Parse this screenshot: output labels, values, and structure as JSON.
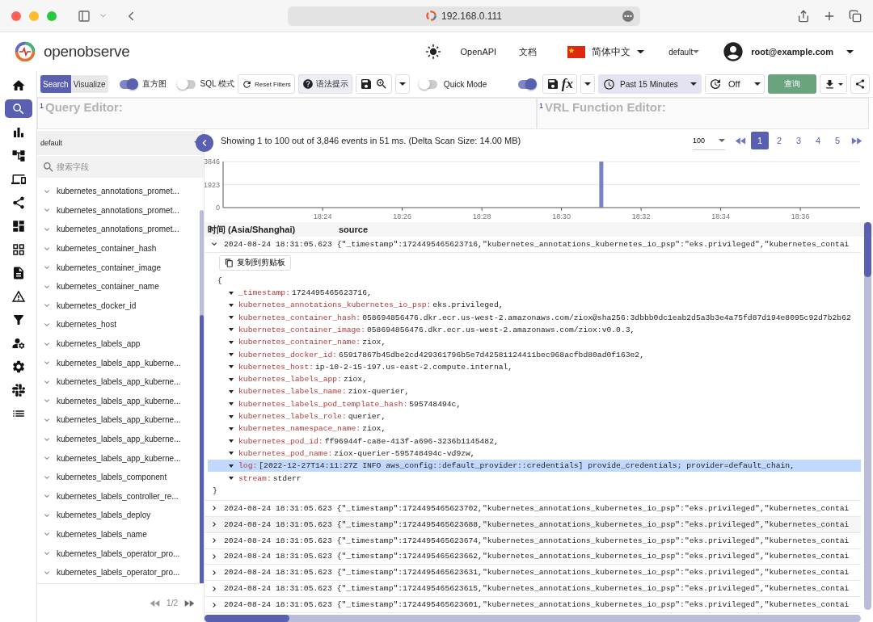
{
  "browser": {
    "url": "192.168.0.111"
  },
  "header": {
    "logo": "openobserve",
    "links": [
      "OpenAPI",
      "文档"
    ],
    "language": "简体中文",
    "org": "default",
    "user": "root@example.com"
  },
  "nav": [
    {
      "kind": "home",
      "selected": false
    },
    {
      "kind": "search",
      "selected": true
    },
    {
      "kind": "metrics",
      "selected": false
    },
    {
      "kind": "traces",
      "selected": false
    },
    {
      "kind": "devices",
      "selected": false
    },
    {
      "kind": "share",
      "selected": false
    },
    {
      "kind": "dashboards",
      "selected": false
    },
    {
      "kind": "grid",
      "selected": false
    },
    {
      "kind": "reports",
      "selected": false
    },
    {
      "kind": "alerts",
      "selected": false
    },
    {
      "kind": "filter",
      "selected": false
    },
    {
      "kind": "users",
      "selected": false
    },
    {
      "kind": "settings",
      "selected": false
    },
    {
      "kind": "slack",
      "selected": false
    },
    {
      "kind": "list",
      "selected": false
    }
  ],
  "toolbar": {
    "tabs": [
      {
        "label": "Search",
        "selected": true
      },
      {
        "label": "Visualize",
        "selected": false
      }
    ],
    "histogram": {
      "label": "直方图",
      "on": true
    },
    "sql_mode": {
      "label": "SQL 模式",
      "on": false
    },
    "reset": "Reset Filters",
    "syntax": "语法提示",
    "quick_mode": {
      "label": "Quick Mode",
      "on": false
    },
    "vrl": {
      "on": true
    },
    "function_label": "fx",
    "time_range": "Past 15 Minutes",
    "refresh": "Off",
    "run": "查询"
  },
  "editors": {
    "query": {
      "line": "1",
      "placeholder": "Query Editor:"
    },
    "vrl": {
      "line": "1",
      "placeholder": "VRL Function Editor:"
    }
  },
  "fields_panel": {
    "stream": "default",
    "search_placeholder": "搜索字段",
    "fields": [
      "kubernetes_annotations_promet...",
      "kubernetes_annotations_promet...",
      "kubernetes_annotations_promet...",
      "kubernetes_container_hash",
      "kubernetes_container_image",
      "kubernetes_container_name",
      "kubernetes_docker_id",
      "kubernetes_host",
      "kubernetes_labels_app",
      "kubernetes_labels_app_kuberne...",
      "kubernetes_labels_app_kuberne...",
      "kubernetes_labels_app_kuberne...",
      "kubernetes_labels_app_kuberne...",
      "kubernetes_labels_app_kuberne...",
      "kubernetes_labels_app_kuberne...",
      "kubernetes_labels_component",
      "kubernetes_labels_controller_re...",
      "kubernetes_labels_deploy",
      "kubernetes_labels_name",
      "kubernetes_labels_operator_pro...",
      "kubernetes_labels_operator_pro..."
    ],
    "pager": "1/2"
  },
  "results": {
    "summary": "Showing 1 to 100 out of 3,846 events in 51 ms. (Delta Scan Size: 14.00 MB)",
    "per_page": "100",
    "pages": [
      {
        "label": "1",
        "selected": true
      },
      {
        "label": "2",
        "selected": false
      },
      {
        "label": "3",
        "selected": false
      },
      {
        "label": "4",
        "selected": false
      },
      {
        "label": "5",
        "selected": false
      }
    ],
    "chart_data": {
      "type": "bar",
      "categories": [
        null,
        null,
        "18:24",
        null,
        "18:26",
        null,
        "18:28",
        null,
        "18:30",
        null,
        "18:32",
        null,
        "18:34",
        null,
        "18:36",
        null
      ],
      "values": [
        0,
        0,
        0,
        0,
        0,
        0,
        0,
        0,
        0,
        3846,
        0,
        0,
        0,
        0,
        0,
        0
      ],
      "ylim": [
        0,
        3846
      ],
      "yticks": [
        0,
        1923,
        3846
      ]
    },
    "table": {
      "columns": [
        "时间 (Asia/Shanghai)",
        "source"
      ],
      "rows": [
        {
          "time": "2024-08-24 18:31:05.623",
          "source": "{\"_timestamp\":1724495465623716,\"kubernetes_annotations_kubernetes_io_psp\":\"eks.privileged\",\"kubernetes_contai",
          "expanded": true,
          "copy_label": "复制到剪贴板",
          "open_brace": "{",
          "close_brace": "}",
          "fields": [
            {
              "key": "_timestamp:",
              "value": "1724495465623716,",
              "highlighted": false
            },
            {
              "key": "kubernetes_annotations_kubernetes_io_psp:",
              "value": "eks.privileged,",
              "highlighted": false
            },
            {
              "key": "kubernetes_container_hash:",
              "value": "058694856476.dkr.ecr.us-west-2.amazonaws.com/ziox@sha256:3dbbb0dc1eab2d5a3b3e4a75fd87d194e8095c92d7b2b62",
              "highlighted": false
            },
            {
              "key": "kubernetes_container_image:",
              "value": "058694856476.dkr.ecr.us-west-2.amazonaws.com/ziox:v0.0.3,",
              "highlighted": false
            },
            {
              "key": "kubernetes_container_name:",
              "value": "ziox,",
              "highlighted": false
            },
            {
              "key": "kubernetes_docker_id:",
              "value": "65917867b45dbe2cd429361796b5e7d42581124411bec968acfbd80ad0f163e2,",
              "highlighted": false
            },
            {
              "key": "kubernetes_host:",
              "value": "ip-10-2-15-197.us-east-2.compute.internal,",
              "highlighted": false
            },
            {
              "key": "kubernetes_labels_app:",
              "value": "ziox,",
              "highlighted": false
            },
            {
              "key": "kubernetes_labels_name:",
              "value": "ziox-querier,",
              "highlighted": false
            },
            {
              "key": "kubernetes_labels_pod_template_hash:",
              "value": "595748494c,",
              "highlighted": false
            },
            {
              "key": "kubernetes_labels_role:",
              "value": "querier,",
              "highlighted": false
            },
            {
              "key": "kubernetes_namespace_name:",
              "value": "ziox,",
              "highlighted": false
            },
            {
              "key": "kubernetes_pod_id:",
              "value": "ff96944f-ca8e-413f-a696-3236b1145482,",
              "highlighted": false
            },
            {
              "key": "kubernetes_pod_name:",
              "value": "ziox-querier-595748494c-vd9zw,",
              "highlighted": false
            },
            {
              "key": "log:",
              "value": "[2022-12-27T14:11:27Z INFO  aws_config::default_provider::credentials] provide_credentials; provider=default_chain,",
              "highlighted": true
            },
            {
              "key": "stream:",
              "value": "stderr",
              "highlighted": false
            }
          ]
        },
        {
          "time": "2024-08-24 18:31:05.623",
          "source": "{\"_timestamp\":1724495465623702,\"kubernetes_annotations_kubernetes_io_psp\":\"eks.privileged\",\"kubernetes_contai",
          "expanded": false
        },
        {
          "time": "2024-08-24 18:31:05.623",
          "source": "{\"_timestamp\":1724495465623688,\"kubernetes_annotations_kubernetes_io_psp\":\"eks.privileged\",\"kubernetes_contai",
          "expanded": false
        },
        {
          "time": "2024-08-24 18:31:05.623",
          "source": "{\"_timestamp\":1724495465623674,\"kubernetes_annotations_kubernetes_io_psp\":\"eks.privileged\",\"kubernetes_contai",
          "expanded": false
        },
        {
          "time": "2024-08-24 18:31:05.623",
          "source": "{\"_timestamp\":1724495465623662,\"kubernetes_annotations_kubernetes_io_psp\":\"eks.privileged\",\"kubernetes_contai",
          "expanded": false
        },
        {
          "time": "2024-08-24 18:31:05.623",
          "source": "{\"_timestamp\":1724495465623631,\"kubernetes_annotations_kubernetes_io_psp\":\"eks.privileged\",\"kubernetes_contai",
          "expanded": false
        },
        {
          "time": "2024-08-24 18:31:05.623",
          "source": "{\"_timestamp\":1724495465623615,\"kubernetes_annotations_kubernetes_io_psp\":\"eks.privileged\",\"kubernetes_contai",
          "expanded": false
        },
        {
          "time": "2024-08-24 18:31:05.623",
          "source": "{\"_timestamp\":1724495465623601,\"kubernetes_annotations_kubernetes_io_psp\":\"eks.privileged\",\"kubernetes_contai",
          "expanded": false
        }
      ]
    }
  }
}
